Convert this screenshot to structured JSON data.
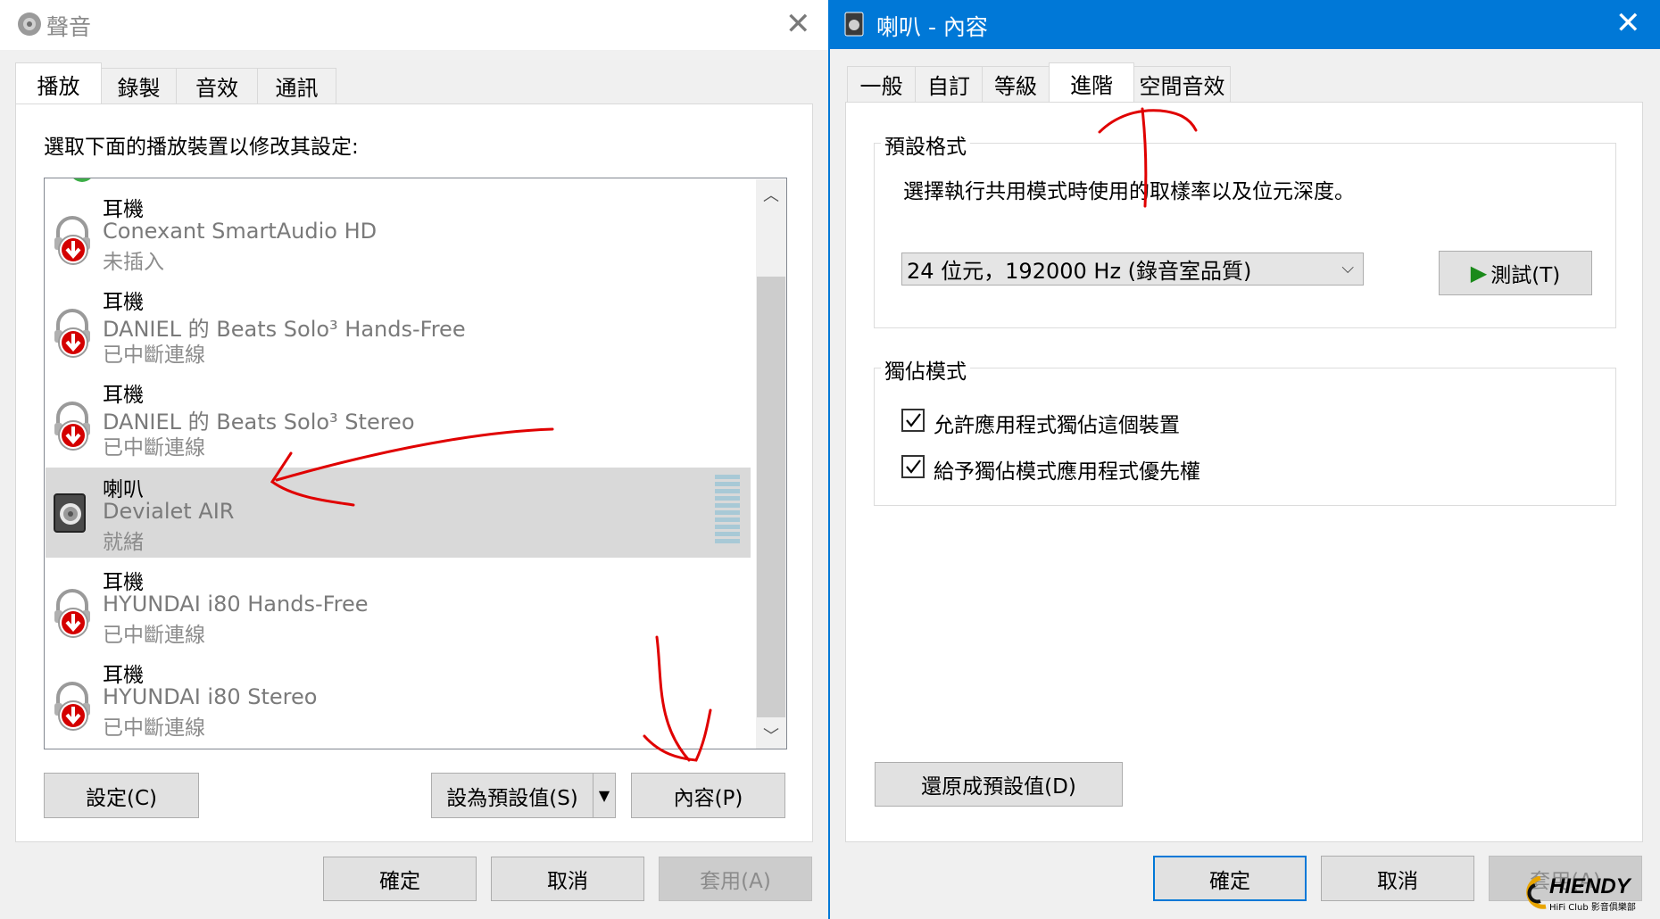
{
  "left_window": {
    "title": "聲音",
    "tabs": [
      {
        "label": "播放"
      },
      {
        "label": "錄製"
      },
      {
        "label": "音效"
      },
      {
        "label": "通訊"
      }
    ],
    "instruction": "選取下面的播放裝置以修改其設定:",
    "devices": [
      {
        "type": "耳機",
        "name": "Conexant SmartAudio HD",
        "status": "未插入",
        "icon": "headphones-unplugged-icon"
      },
      {
        "type": "耳機",
        "name": "DANIEL 的 Beats Solo³ Hands-Free",
        "status": "已中斷連線",
        "icon": "headphones-disconnected-icon"
      },
      {
        "type": "耳機",
        "name": "DANIEL 的 Beats Solo³ Stereo",
        "status": "已中斷連線",
        "icon": "headphones-disconnected-icon"
      },
      {
        "type": "喇叭",
        "name": "Devialet AIR",
        "status": "就緒",
        "icon": "speaker-icon",
        "selected": true
      },
      {
        "type": "耳機",
        "name": "HYUNDAI i80 Hands-Free",
        "status": "已中斷連線",
        "icon": "headphones-disconnected-icon"
      },
      {
        "type": "耳機",
        "name": "HYUNDAI i80 Stereo",
        "status": "已中斷連線",
        "icon": "headphones-disconnected-icon"
      }
    ],
    "buttons": {
      "configure": "設定(C)",
      "set_default": "設為預設值(S)",
      "properties": "內容(P)",
      "ok": "確定",
      "cancel": "取消",
      "apply": "套用(A)"
    }
  },
  "right_window": {
    "title": "喇叭 - 內容",
    "tabs": [
      {
        "label": "一般"
      },
      {
        "label": "自訂"
      },
      {
        "label": "等級"
      },
      {
        "label": "進階"
      },
      {
        "label": "空間音效"
      }
    ],
    "default_format": {
      "group_label": "預設格式",
      "description": "選擇執行共用模式時使用的取樣率以及位元深度。",
      "selected_format": "24 位元，192000 Hz (錄音室品質)",
      "test_button": "測試(T)"
    },
    "exclusive_mode": {
      "group_label": "獨佔模式",
      "options": [
        {
          "label": "允許應用程式獨佔這個裝置",
          "checked": true
        },
        {
          "label": "給予獨佔模式應用程式優先權",
          "checked": true
        }
      ]
    },
    "buttons": {
      "restore_defaults": "還原成預設值(D)",
      "ok": "確定",
      "cancel": "取消",
      "apply": "套用(A)"
    }
  },
  "watermark": {
    "brand": "HIENDY",
    "sub": "HiFi Club 影音俱樂部"
  },
  "colors": {
    "accent": "#0078d7",
    "annotation": "#e00000",
    "disconnect_badge": "#d40000"
  }
}
